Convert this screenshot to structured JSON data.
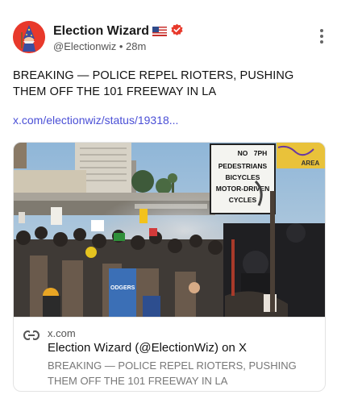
{
  "post": {
    "author_name": "Election Wizard",
    "handle": "@Electionwiz",
    "separator": "•",
    "time_ago": "28m",
    "text": "BREAKING — POLICE REPEL RIOTERS, PUSHING THEM OFF THE 101 FREEWAY IN LA",
    "link_text": "x.com/electionwiz/status/19318..."
  },
  "card": {
    "domain": "x.com",
    "title": "Election Wizard (@ElectionWiz) on X",
    "description": "BREAKING — POLICE REPEL RIOTERS, PUSHING THEM OFF THE 101 FREEWAY IN LA",
    "sign_text": [
      "NO",
      "PEDESTRIANS",
      "BICYCLES",
      "MOTOR-DRIVEN",
      "CYCLES"
    ],
    "sign_partial": "7PH",
    "banner_text": "AREA",
    "jersey_text": "ODGERS"
  },
  "icons": {
    "avatar": "wizard-avatar",
    "flag": "us-flag-icon",
    "verified": "verified-badge-icon",
    "more": "more-vertical-icon",
    "link": "link-icon"
  },
  "colors": {
    "link": "#4a4fd6",
    "avatar_bg": "#e8392b",
    "verified": "#e8392b"
  }
}
